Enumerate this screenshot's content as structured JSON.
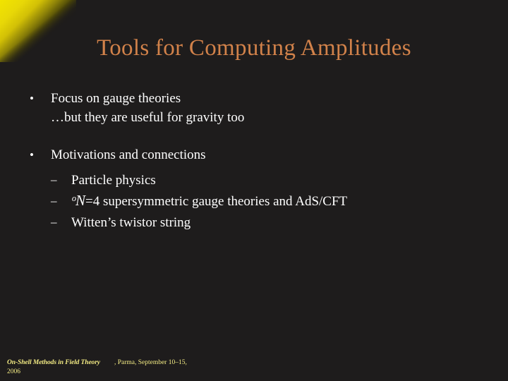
{
  "slide": {
    "title": "Tools for Computing Amplitudes",
    "background_color": "#1e1c1c",
    "title_color": "#d2824a",
    "body_text_color": "#ffffff",
    "footer_color": "#f4ec84",
    "accent_color": "#f2e400"
  },
  "decor": {
    "corner_wedge_name": "yellow-corner-wedge"
  },
  "content": {
    "bullets": [
      {
        "marker": "•",
        "text": "Focus on gauge theories",
        "subline": "…but they are useful for gravity too",
        "sub_items": []
      },
      {
        "marker": "•",
        "text": "Motivations and connections",
        "subline": "",
        "sub_items": [
          {
            "marker": "–",
            "text": "Particle physics",
            "math_prefix": ""
          },
          {
            "marker": "–",
            "text": "=4 supersymmetric gauge theories and AdS/CFT",
            "math_prefix": "ᵒΝ"
          },
          {
            "marker": "–",
            "text": "Witten’s twistor string",
            "math_prefix": ""
          }
        ]
      }
    ]
  },
  "footer": {
    "venue": "On-Shell Methods in Field Theory",
    "details": ", Parma, September 10–15,",
    "year": "2006"
  }
}
